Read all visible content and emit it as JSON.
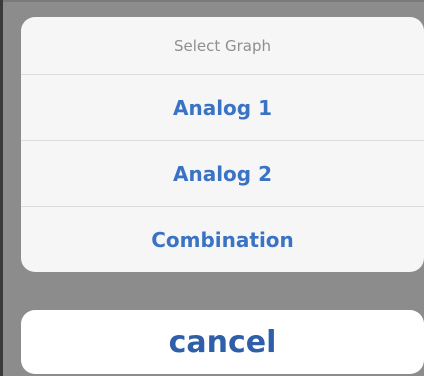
{
  "action_sheet": {
    "title": "Select Graph",
    "options": [
      {
        "label": "Analog 1"
      },
      {
        "label": "Analog 2"
      },
      {
        "label": "Combination"
      }
    ],
    "cancel_label": "cancel"
  },
  "colors": {
    "backdrop": "#8c8c8c",
    "sheet_background": "#f6f6f6",
    "option_text": "#3b73c4",
    "cancel_text": "#2e5fa8",
    "title_text": "#8e8e93"
  }
}
